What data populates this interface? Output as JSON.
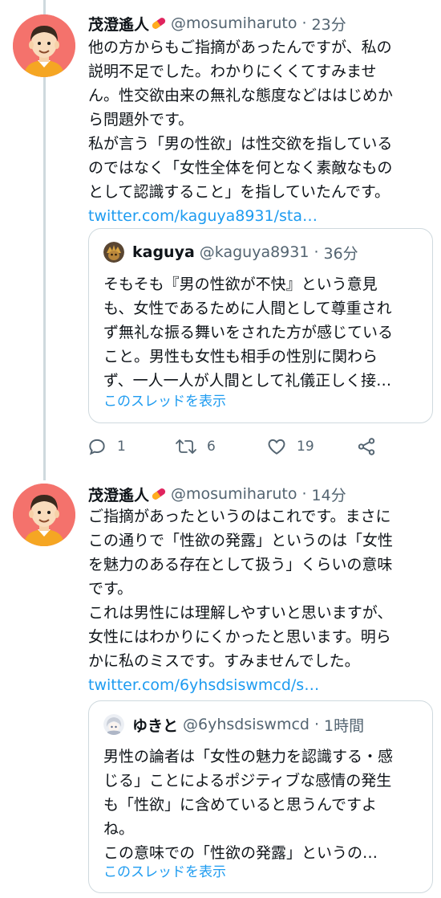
{
  "tweets": [
    {
      "author": {
        "name": "茂澄遙人",
        "handle": "@mosumiharuto",
        "avatar_icon": "person-avatar-icon",
        "badge_icon": "pill-icon"
      },
      "separator": "·",
      "time": "23分",
      "body_lines": [
        "他の方からもご指摘があったんですが、私の",
        "説明不足でした。わかりにくくてすみませ",
        "ん。性交欲由来の無礼な態度などははじめか",
        "ら問題外です。",
        "私が言う「男の性欲」は性交欲を指している",
        "のではなく「女性全体を何となく素敵なもの",
        "として認識すること」を指していたんです。"
      ],
      "link": "twitter.com/kaguya8931/sta…",
      "quote": {
        "name": "kaguya",
        "handle": "@kaguya8931",
        "separator": "·",
        "time": "36分",
        "body_lines": [
          "そもそも『男の性欲が不快』という意見",
          "も、女性であるために人間として尊重され",
          "ず無礼な振る舞いをされた方が感じている",
          "こと。男性も女性も相手の性別に関わら",
          "ず、一人一人が人間として礼儀正しく接…"
        ],
        "show_thread": "このスレッドを表示"
      },
      "actions": {
        "reply_count": "1",
        "retweet_count": "6",
        "like_count": "19"
      }
    },
    {
      "author": {
        "name": "茂澄遙人",
        "handle": "@mosumiharuto",
        "avatar_icon": "person-avatar-icon",
        "badge_icon": "pill-icon"
      },
      "separator": "·",
      "time": "14分",
      "body_lines": [
        "ご指摘があったというのはこれです。まさに",
        "この通りで「性欲の発露」というのは「女性",
        "を魅力のある存在として扱う」くらいの意味",
        "です。",
        "これは男性には理解しやすいと思いますが、",
        "女性にはわかりにくかったと思います。明ら",
        "かに私のミスです。すみませんでした。"
      ],
      "link": "twitter.com/6yhsdsiswmcd/s…",
      "quote": {
        "name": "ゆきと",
        "handle": "@6yhsdsiswmcd",
        "separator": "·",
        "time": "1時間",
        "body_lines": [
          "男性の論者は「女性の魅力を認識する・感",
          "じる」ことによるポジティブな感情の発生",
          "も「性欲」に含めていると思うんですよ",
          "ね。",
          "この意味での「性欲の発露」というの…"
        ],
        "show_thread": "このスレッドを表示"
      }
    }
  ],
  "colors": {
    "link": "#1d9bf0",
    "muted": "#536471",
    "avatar_bg": "#f4726c",
    "border": "#cfd9de"
  }
}
